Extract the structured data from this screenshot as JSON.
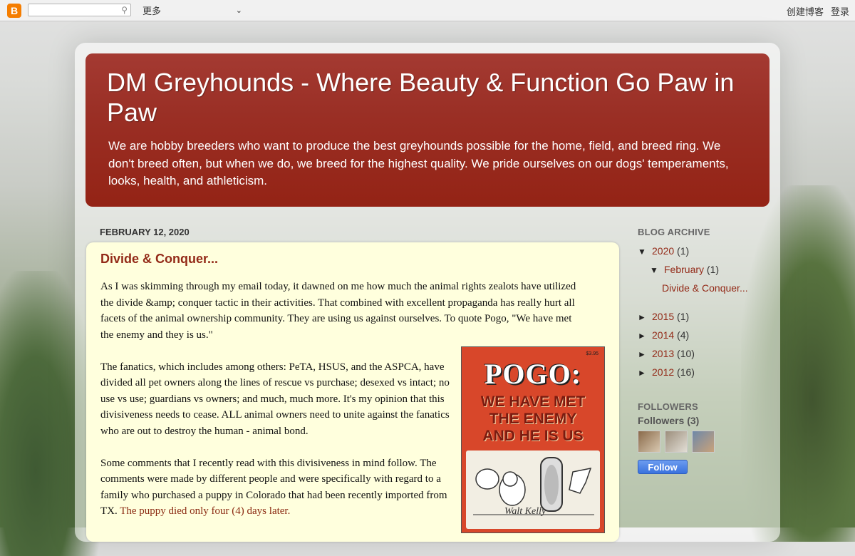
{
  "navbar": {
    "logo_letter": "B",
    "search_placeholder": "",
    "more_label": "更多",
    "create_blog": "创建博客",
    "login": "登录"
  },
  "header": {
    "title": "DM Greyhounds - Where Beauty & Function Go Paw in Paw",
    "description": "We are hobby breeders who want to produce the best greyhounds possible for the home, field, and breed ring. We don't breed often, but when we do, we breed for the highest quality. We pride ourselves on our dogs' temperaments, looks, health, and athleticism."
  },
  "post": {
    "date": "FEBRUARY 12, 2020",
    "title": "Divide & Conquer...",
    "paragraphs": [
      "As I was skimming through my email today, it dawned on me how much the animal rights zealots have utilized the divide &amp; conquer tactic in their activities. That combined with excellent propaganda has really hurt all facets of the animal ownership community.  They are using us against ourselves.  To quote Pogo, \"We have met the enemy and they is us.\"",
      "The fanatics, which includes among others: PeTA, HSUS, and the ASPCA, have divided all pet owners along the lines of rescue vs purchase; desexed vs intact; no use vs use; guardians vs owners; and much, much more. It's my opinion that this divisiveness needs to cease. ALL animal owners need to unite against the fanatics who are out to destroy the human - animal bond.",
      "Some comments that I recently read with this divisiveness in mind follow. The comments were made by different people and were specifically with regard to a family who purchased a puppy in Colorado that had been recently imported from TX. "
    ],
    "link_text": "The puppy died only four (4) days later.",
    "image": {
      "price": "$3.95",
      "title": "POGO:",
      "tagline_lines": [
        "WE HAVE MET",
        "THE ENEMY",
        "AND HE IS US"
      ],
      "signature": "Walt Kelly"
    }
  },
  "sidebar": {
    "archive_title": "BLOG ARCHIVE",
    "archive": [
      {
        "toggle": "▼",
        "label": "2020",
        "count": "(1)",
        "indent": 0
      },
      {
        "toggle": "▼",
        "label": "February",
        "count": "(1)",
        "indent": 1
      },
      {
        "toggle": "",
        "label": "Divide & Conquer...",
        "count": "",
        "indent": 2
      },
      {
        "toggle": "►",
        "label": "2015",
        "count": "(1)",
        "indent": 0
      },
      {
        "toggle": "►",
        "label": "2014",
        "count": "(4)",
        "indent": 0
      },
      {
        "toggle": "►",
        "label": "2013",
        "count": "(10)",
        "indent": 0
      },
      {
        "toggle": "►",
        "label": "2012",
        "count": "(16)",
        "indent": 0
      }
    ],
    "followers_title": "FOLLOWERS",
    "followers_count": "Followers (3)",
    "follow_button": "Follow",
    "follower_thumb_colors": [
      "#8a6a4a",
      "#9c8e7c",
      "#6e88a8"
    ]
  }
}
